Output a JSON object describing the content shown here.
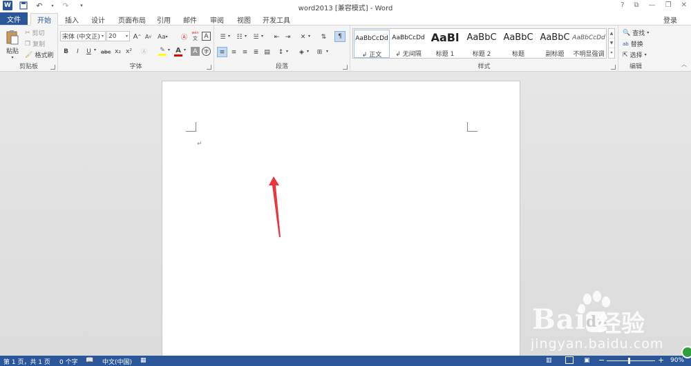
{
  "window": {
    "title": "word2013 [兼容模式] - Word",
    "controls": [
      "?",
      "⧉",
      "—",
      "❐",
      "✕"
    ]
  },
  "qat": {
    "app_icon": "W",
    "icons": [
      "save-icon",
      "undo-icon",
      "redo-icon",
      "customize-icon"
    ]
  },
  "tabs": {
    "file": "文件",
    "items": [
      "开始",
      "插入",
      "设计",
      "页面布局",
      "引用",
      "邮件",
      "审阅",
      "视图",
      "开发工具"
    ],
    "active": "开始",
    "login": "登录"
  },
  "ribbon": {
    "clipboard": {
      "label": "剪贴板",
      "paste": "粘贴",
      "cut": "剪切",
      "copy": "复制",
      "format_painter": "格式刷"
    },
    "font": {
      "label": "字体",
      "font_name": "宋体 (中文正)",
      "font_size": "20",
      "grow": "A",
      "shrink": "A",
      "case": "Aa",
      "bold": "B",
      "italic": "I",
      "underline": "U",
      "strike": "abc",
      "subscript": "x₂",
      "superscript": "x²",
      "font_color": "A",
      "char_shade": "A",
      "char_border": "A",
      "enclose": "字",
      "phonetic": "文"
    },
    "paragraph": {
      "label": "段落"
    },
    "styles": {
      "label": "样式",
      "items": [
        {
          "sample": "AaBbCcDd",
          "name": "↲ 正文"
        },
        {
          "sample": "AaBbCcDd",
          "name": "↲ 无间隔"
        },
        {
          "sample": "AaBl",
          "name": "标题 1"
        },
        {
          "sample": "AaBbC",
          "name": "标题 2"
        },
        {
          "sample": "AaBbC",
          "name": "标题"
        },
        {
          "sample": "AaBbC",
          "name": "副标题"
        },
        {
          "sample": "AaBbCcDd",
          "name": "不明显强调"
        }
      ]
    },
    "editing": {
      "label": "编辑",
      "find": "查找",
      "replace": "替换",
      "select": "选择"
    }
  },
  "document": {
    "paragraph_mark": "↵"
  },
  "watermark": {
    "brand": "Bai",
    "brand_cn": "经验",
    "url": "jingyan.baidu.com"
  },
  "status": {
    "page": "第 1 页，共 1 页",
    "words": "0 个字",
    "language": "中文(中国)",
    "zoom": "90%"
  },
  "colors": {
    "accent": "#2b579a",
    "highlight": "#ffff00",
    "font_color": "#e00000",
    "arrow": "#e8383d"
  }
}
